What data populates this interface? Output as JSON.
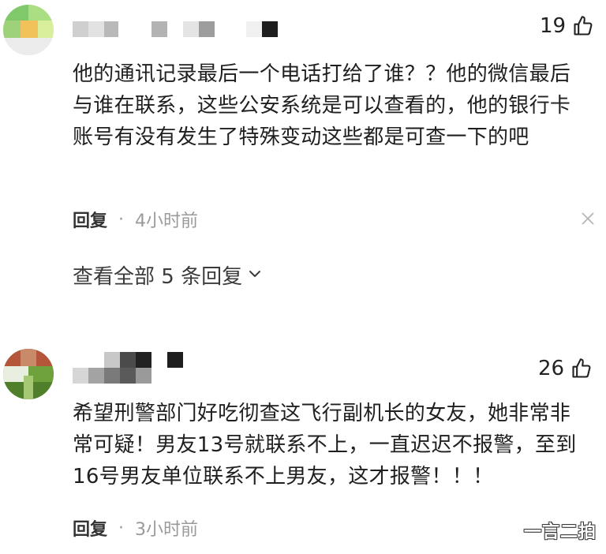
{
  "comments": [
    {
      "likes": "19",
      "text": "他的通讯记录最后一个电话打给了谁？？他的微信最后与谁在联系，这些公安系统是可以查看的，他的银行卡账号有没有发生了特殊变动这些都是可查一下的吧",
      "reply_label": "回复",
      "separator": "·",
      "time": "4小时前",
      "view_all": "查看全部 5 条回复"
    },
    {
      "likes": "26",
      "text": "希望刑警部门好吃彻查这飞行副机长的女友，她非常非常可疑！男友13号就联系不上，一直迟迟不报警，至到16号男友单位联系不上男友，这才报警！！！",
      "reply_label": "回复",
      "separator": "·",
      "time": "3小时前"
    }
  ],
  "watermark": "一言二拍",
  "icons": {
    "like": "thumbs-up-icon",
    "close": "close-icon",
    "chevron": "chevron-down-icon"
  },
  "colors": {
    "text": "#1f1f1f",
    "meta": "#9a9a9a"
  }
}
